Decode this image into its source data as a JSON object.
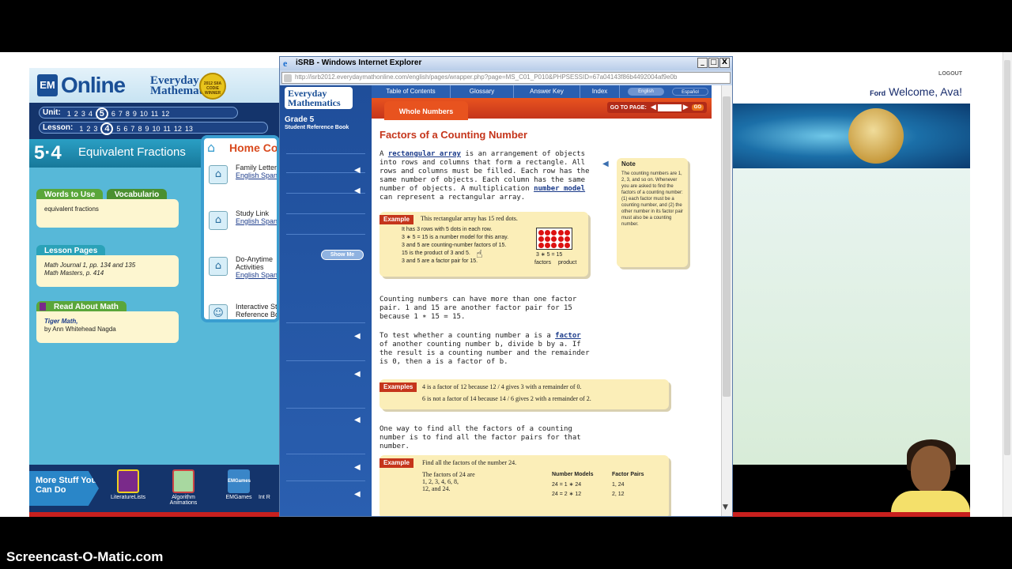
{
  "app": {
    "logo_em": "EM",
    "logo_online": "Online",
    "logo_everyday": "Everyday",
    "logo_mathematics": "Mathematics",
    "badge_text": "2012 SIIA CODiE WINNER",
    "unit_label": "Unit:",
    "unit_numbers": [
      "1",
      "2",
      "3",
      "4",
      "5",
      "6",
      "7",
      "8",
      "9",
      "10",
      "11",
      "12"
    ],
    "unit_current": "5",
    "lesson_label": "Lesson:",
    "lesson_numbers": [
      "1",
      "2",
      "3",
      "4",
      "5",
      "6",
      "7",
      "8",
      "9",
      "10",
      "11",
      "12",
      "13"
    ],
    "lesson_current": "4",
    "lesson_number": "5·4",
    "lesson_title": "Equivalent Fractions",
    "tab_words": "Words to Use",
    "tab_vocab": "Vocabulario",
    "words_content": "equivalent fractions",
    "lesson_pages_label": "Lesson Pages",
    "lesson_pages_1": "Math Journal 1, pp. 134 and 135",
    "lesson_pages_2": "Math Masters, p. 414",
    "read_label": "Read About Math",
    "read_book": "Tiger Math,",
    "read_author": "by Ann Whitehead Nagda",
    "home_title": "Home Conn",
    "home_items": [
      {
        "label": "Family Letters",
        "en": "English",
        "sp": "Span"
      },
      {
        "label": "Study Link",
        "en": "English",
        "sp": "Span"
      },
      {
        "label": "Do-Anytime Activities",
        "en": "English",
        "sp": "Span"
      },
      {
        "label": "Interactive St Reference Bo",
        "en": "English",
        "sp": "Span"
      }
    ],
    "more_stuff": "More Stuff You Can Do",
    "more_items": [
      "LiteratureLists",
      "Algorithm Animations",
      "EMGames",
      "Int R"
    ],
    "emgames_icon": "EMGames",
    "logout": "LOGOUT",
    "user_first": "Ford",
    "welcome": "Welcome, Ava!"
  },
  "ie": {
    "title": "iSRB - Windows Internet Explorer",
    "url": "http://isrb2012.everydaymathonline.com/english/pages/wrapper.php?page=MS_C01_P010&PHPSESSID=67a04143f86b4492004af9e0b",
    "btn_min": "_",
    "btn_max": "□",
    "btn_close": "X"
  },
  "isrb": {
    "logo_line1": "Everyday",
    "logo_line2": "Mathematics",
    "grade": "Grade 5",
    "srb": "Student Reference Book",
    "show_me": "Show Me",
    "tabs": [
      "Table of Contents",
      "Glossary",
      "Answer Key",
      "Index"
    ],
    "lang_en": "English",
    "lang_es": "Español",
    "goto_label": "GO TO PAGE:",
    "go": "GO",
    "section_tab": "Whole Numbers",
    "page_title": "Factors of a Counting Number",
    "p1_a": "A ",
    "p1_link1": "rectangular array",
    "p1_b": " is an arrangement of objects into rows and columns that form a rectangle. All rows and columns must be filled. Each row has the same number of objects. Each column has the same number of objects. A multiplication ",
    "p1_link2": "number model",
    "p1_c": " can represent a rectangular array.",
    "ex1_tag": "Example",
    "ex1_head": "This rectangular array has 15 red dots.",
    "ex1_l1": "It has 3 rows with 5 dots in each row.",
    "ex1_l2": "3 ∗ 5 = 15 is a number model for this array.",
    "ex1_l3": "3 and 5 are counting-number factors of 15.",
    "ex1_l4": "15 is the product of 3 and 5.",
    "ex1_l5": "3 and 5 are a factor pair for 15.",
    "ex1_eq": "3 ∗ 5 = 15",
    "ex1_factors": "factors",
    "ex1_product": "product",
    "p2": "Counting numbers can have more than one factor pair. 1 and 15 are another factor pair for 15 because 1 ∗ 15 = 15.",
    "p3_a": "To test whether a counting number a is a ",
    "p3_link": "factor",
    "p3_b": " of another counting number b, divide b by a. If the result is a counting number and the remainder is 0, then a is a factor of b.",
    "ex2_tag": "Examples",
    "ex2_l1": "4 is a factor of 12 because 12 / 4 gives 3 with a remainder of 0.",
    "ex2_l2": "6 is not a factor of 14 because 14 / 6 gives 2 with a remainder of 2.",
    "p4": "One way to find all the factors of a counting number is to find all the factor pairs for that number.",
    "ex3_tag": "Example",
    "ex3_head": "Find all the factors of the number 24.",
    "ex3_c1": "The factors of 24 are",
    "ex3_c1b": "1, 2, 3, 4, 6, 8,",
    "ex3_c1c": "12, and 24.",
    "ex3_h2": "Number Models",
    "ex3_h3": "Factor Pairs",
    "ex3_r1a": "24 = 1 ∗ 24",
    "ex3_r1b": "1, 24",
    "ex3_r2a": "24 = 2 ∗ 12",
    "ex3_r2b": "2, 12",
    "note_title": "Note",
    "note_body": "The counting numbers are 1, 2, 3, and so on. Whenever you are asked to find the factors of a counting number: (1) each factor must be a counting number, and (2) the other number in its factor pair must also be a counting number."
  },
  "watermark": "Screencast-O-Matic.com"
}
